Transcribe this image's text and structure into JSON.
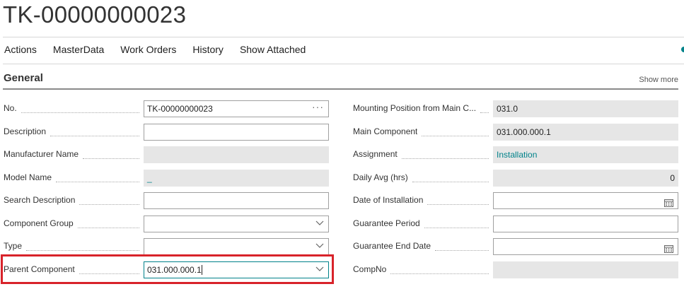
{
  "page": {
    "title": "TK-00000000023"
  },
  "menu": {
    "items": [
      "Actions",
      "MasterData",
      "Work Orders",
      "History",
      "Show Attached"
    ]
  },
  "section": {
    "title": "General",
    "show_more": "Show more"
  },
  "left_fields": [
    {
      "label": "No.",
      "value": "TK-00000000023",
      "kind": "edit-ellipsis"
    },
    {
      "label": "Description",
      "value": "",
      "kind": "edit"
    },
    {
      "label": "Manufacturer Name",
      "value": "",
      "kind": "readonly"
    },
    {
      "label": "Model Name",
      "value": "_",
      "kind": "readonly-link"
    },
    {
      "label": "Search Description",
      "value": "",
      "kind": "edit"
    },
    {
      "label": "Component Group",
      "value": "",
      "kind": "dropdown"
    },
    {
      "label": "Type",
      "value": "",
      "kind": "dropdown"
    },
    {
      "label": "Parent Component",
      "value": "031.000.000.1",
      "kind": "dropdown-focused"
    }
  ],
  "right_fields": [
    {
      "label": "Mounting Position from Main C...",
      "value": "031.0",
      "kind": "readonly"
    },
    {
      "label": "Main Component",
      "value": "031.000.000.1",
      "kind": "readonly"
    },
    {
      "label": "Assignment",
      "value": "Installation",
      "kind": "readonly-link"
    },
    {
      "label": "Daily Avg (hrs)",
      "value": "0",
      "kind": "readonly-number"
    },
    {
      "label": "Date of Installation",
      "value": "",
      "kind": "date"
    },
    {
      "label": "Guarantee Period",
      "value": "",
      "kind": "edit"
    },
    {
      "label": "Guarantee End Date",
      "value": "",
      "kind": "date"
    },
    {
      "label": "CompNo",
      "value": "",
      "kind": "readonly"
    }
  ],
  "colors": {
    "accent": "#00828a",
    "highlight": "#d8232a",
    "readonly_bg": "#e6e6e6"
  }
}
